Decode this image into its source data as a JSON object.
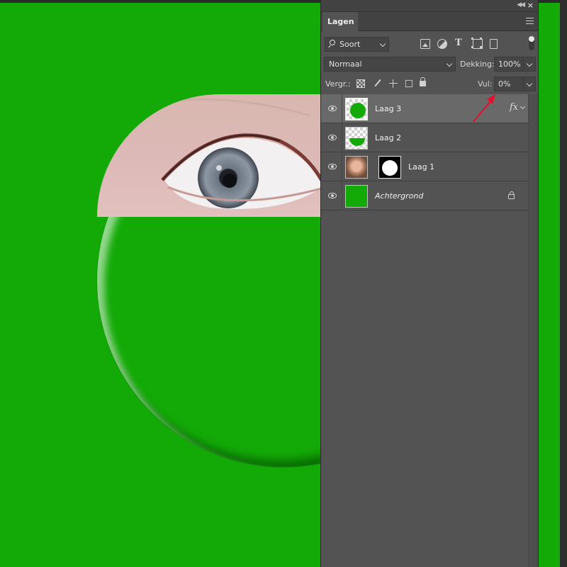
{
  "colors": {
    "canvas_green": "#13aa07",
    "panel_bg": "#535353",
    "selected_row": "#696969",
    "arrow_red": "#e0102a"
  },
  "panel": {
    "tab_label": "Lagen",
    "collapse_icon": "double-chevron-left-icon",
    "close_icon": "close-icon",
    "menu_icon": "hamburger-menu-icon"
  },
  "filter": {
    "kind_label": "Soort",
    "icons": [
      "image-filter-icon",
      "adjustment-filter-icon",
      "type-filter-icon",
      "shape-filter-icon",
      "smart-object-filter-icon"
    ]
  },
  "blend": {
    "mode": "Normaal",
    "opacity_label": "Dekking:",
    "opacity_value": "100%"
  },
  "lock": {
    "label": "Vergr.:",
    "fill_label": "Vul:",
    "fill_value": "0%"
  },
  "layers": [
    {
      "name": "Laag 3",
      "selected": true,
      "fx": "fx"
    },
    {
      "name": "Laag 2",
      "selected": false
    },
    {
      "name": "Laag 1",
      "selected": false,
      "mask": true
    },
    {
      "name": "Achtergrond",
      "selected": false,
      "locked": true
    }
  ]
}
